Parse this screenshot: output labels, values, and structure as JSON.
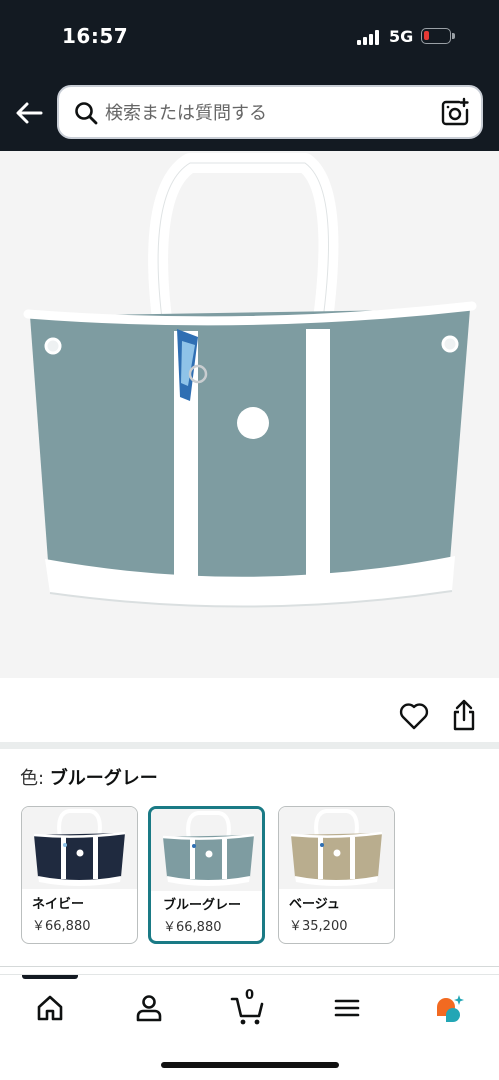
{
  "status_bar": {
    "time": "16:57",
    "network": "5G",
    "battery_level": 0.2,
    "battery_color": "#e53935"
  },
  "header": {
    "background": "#131a22",
    "back_icon": "arrow-left-icon",
    "search": {
      "placeholder": "検索または質問する",
      "value": "",
      "icon": "search-icon"
    },
    "camera_icon": "camera-plus-icon"
  },
  "product": {
    "image_alt": "ブルーグレー トートバッグ",
    "actions": {
      "favorite_icon": "heart-icon",
      "share_icon": "share-icon"
    },
    "color_selector": {
      "label": "色: ",
      "selected": "ブルーグレー",
      "options": [
        {
          "name": "ネイビー",
          "price": "￥66,880",
          "color": "#1f2a3f",
          "selected": false
        },
        {
          "name": "ブルーグレー",
          "price": "￥66,880",
          "color": "#7e9ca1",
          "selected": true
        },
        {
          "name": "ベージュ",
          "price": "￥35,200",
          "color": "#b9ad8e",
          "selected": false
        }
      ],
      "accent_color": "#1a7a85"
    }
  },
  "bottom_nav": {
    "items": [
      {
        "name": "home",
        "icon": "home-icon",
        "active": true
      },
      {
        "name": "account",
        "icon": "user-icon",
        "active": false
      },
      {
        "name": "cart",
        "icon": "cart-icon",
        "active": false,
        "count": "0"
      },
      {
        "name": "menu",
        "icon": "hamburger-menu-icon",
        "active": false
      },
      {
        "name": "rufus",
        "icon": "rufus-chat-icon",
        "active": false
      }
    ]
  }
}
